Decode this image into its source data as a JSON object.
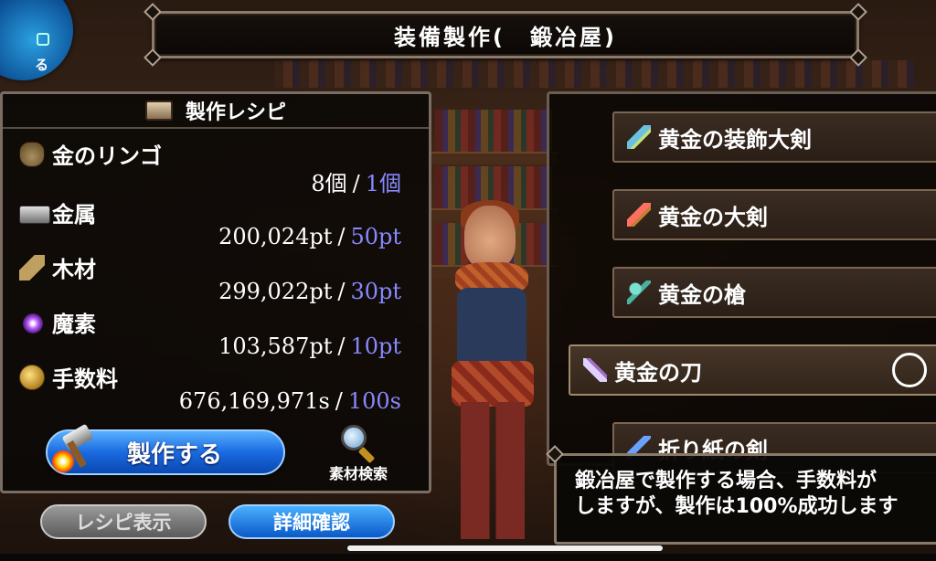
{
  "header": {
    "title": "装備製作(　鍛冶屋)"
  },
  "top_left_button": {
    "label": "る"
  },
  "recipe": {
    "title": "製作レシピ",
    "materials": [
      {
        "name": "金のリンゴ",
        "icon": "golden-apple-icon",
        "have": "8個",
        "need": "1個"
      },
      {
        "name": "金属",
        "icon": "metal-ingot-icon",
        "have": "200,024pt",
        "need": "50pt"
      },
      {
        "name": "木材",
        "icon": "wood-icon",
        "have": "299,022pt",
        "need": "30pt"
      },
      {
        "name": "魔素",
        "icon": "magic-orb-icon",
        "have": "103,587pt",
        "need": "10pt"
      },
      {
        "name": "手数料",
        "icon": "coin-icon",
        "have": "676,169,971s",
        "need": "100s"
      }
    ],
    "separator": "/",
    "craft_button": "製作する",
    "search_label": "素材検索"
  },
  "bottom_buttons": {
    "recipe_view": "レシピ表示",
    "details": "詳細確認"
  },
  "items": [
    {
      "name": "黄金の装飾大剣",
      "icon": "ornate-greatsword-icon"
    },
    {
      "name": "黄金の大剣",
      "icon": "greatsword-icon"
    },
    {
      "name": "黄金の槍",
      "icon": "spear-icon"
    },
    {
      "name": "黄金の刀",
      "icon": "katana-icon",
      "selected": true
    },
    {
      "name": "折り紙の剣",
      "icon": "paper-sword-icon"
    }
  ],
  "message": {
    "line1": "鍛冶屋で製作する場合、手数料が",
    "line2": "しますが、製作は100%成功します"
  },
  "colors": {
    "need_value": "#8888ff",
    "craft_button": "#1a6ae0",
    "frame": "#8a7a6a"
  }
}
